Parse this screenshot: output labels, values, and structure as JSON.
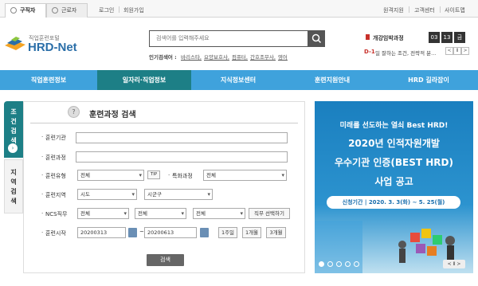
{
  "topbar": {
    "tabs": [
      "구직자",
      "근로자"
    ],
    "links_left": [
      "로그인",
      "회원가입"
    ],
    "links_right": [
      "원격지원",
      "고객센터",
      "사이트맵"
    ]
  },
  "header": {
    "logo_sub": "직업훈련포털",
    "logo_main": "HRD-Net",
    "search_placeholder": "검색어를 입력해주세요",
    "popular_label": "인기검색어 :",
    "popular_words": [
      "바리스타,",
      "요양보호사,",
      "컴퓨터,",
      "간호조무사,",
      "영어"
    ],
    "countdown_title": "개강임박과정",
    "countdown": [
      "03",
      "13",
      "금"
    ],
    "dday": "D-1",
    "dday_text": "일 잘하는 조건, 전략적 분...",
    "pager": [
      "<",
      "Ⅱ",
      ">"
    ]
  },
  "nav": [
    "직업훈련정보",
    "일자리·직업정보",
    "지식정보센터",
    "훈련지원안내",
    "HRD 길라잡이"
  ],
  "left_tabs": {
    "tab1": "조건검색",
    "tab2": "지역검색"
  },
  "form": {
    "title": "훈련과정 검색",
    "labels": {
      "org": "훈련기관",
      "course": "훈련과정",
      "type": "훈련유형",
      "special": "특화과정",
      "region": "훈련지역",
      "ncs": "NCS직무",
      "start": "훈련시작"
    },
    "type_value": "전체",
    "tip": "TIP",
    "special_value": "전체",
    "region_city": "시도",
    "region_district": "시군구",
    "ncs_values": [
      "전체",
      "전체",
      "전체"
    ],
    "ncs_button": "직무 선택하기",
    "date_from": "20200313",
    "date_to": "20200613",
    "tilde": "~",
    "period_buttons": [
      "1주일",
      "1개월",
      "3개월"
    ],
    "submit": "검색"
  },
  "banner": {
    "line1": "미래를 선도하는 열쇠 Best HRD!",
    "line2": "2020년 인적자원개발",
    "line3": "우수기관 인증(BEST HRD)",
    "line4": "사업 공고",
    "period": "신청기간 | 2020. 3. 3(화) ~ 5. 25(월)",
    "control": "< Ⅱ >"
  }
}
